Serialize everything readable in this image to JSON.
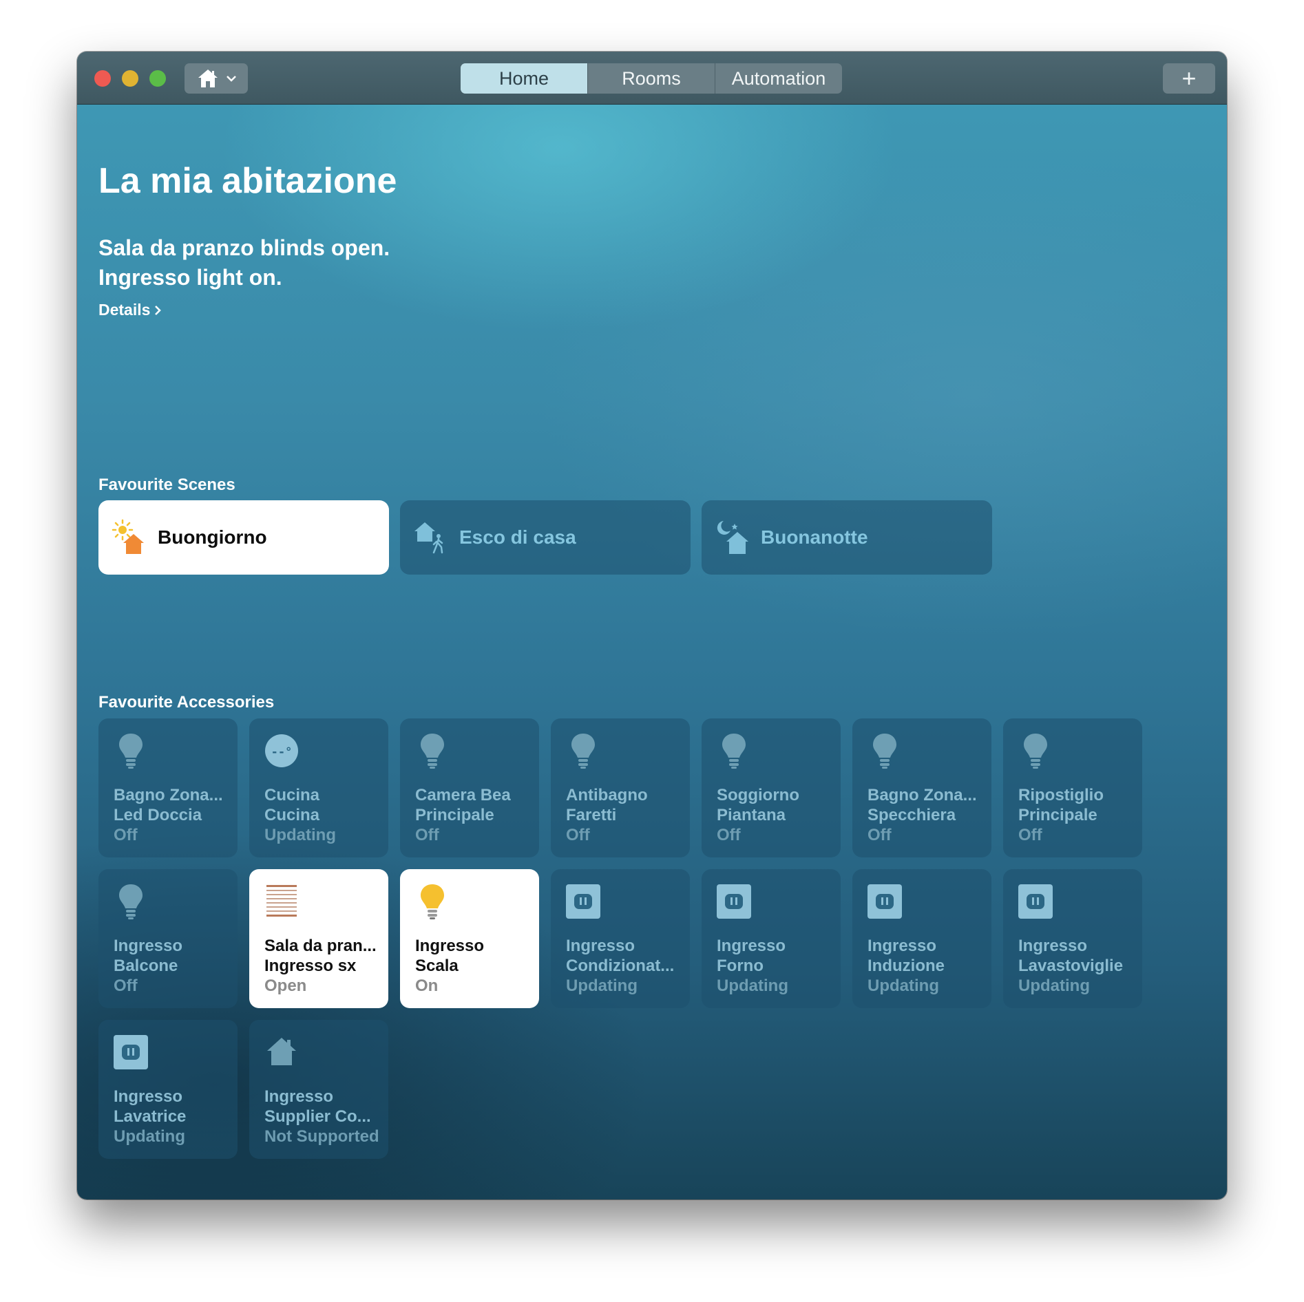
{
  "toolbar": {
    "tabs": [
      "Home",
      "Rooms",
      "Automation"
    ],
    "active_tab": "Home",
    "add_label": "+"
  },
  "home": {
    "title": "La mia abitazione",
    "status_lines": [
      "Sala da pranzo blinds open.",
      "Ingresso light on."
    ],
    "details_label": "Details"
  },
  "scenes": {
    "title": "Favourite Scenes",
    "items": [
      {
        "name": "Buongiorno",
        "icon": "sunrise-home-icon",
        "on": true
      },
      {
        "name": "Esco di casa",
        "icon": "leave-home-icon",
        "on": false
      },
      {
        "name": "Buonanotte",
        "icon": "night-home-icon",
        "on": false
      }
    ]
  },
  "accessories": {
    "title": "Favourite Accessories",
    "items": [
      {
        "room": "Bagno Zona...",
        "name": "Led Doccia",
        "state": "Off",
        "icon": "lightbulb-icon",
        "on": false
      },
      {
        "room": "Cucina",
        "name": "Cucina",
        "state": "Updating",
        "icon": "thermostat-icon",
        "on": false
      },
      {
        "room": "Camera Bea",
        "name": "Principale",
        "state": "Off",
        "icon": "lightbulb-icon",
        "on": false
      },
      {
        "room": "Antibagno",
        "name": "Faretti",
        "state": "Off",
        "icon": "lightbulb-icon",
        "on": false
      },
      {
        "room": "Soggiorno",
        "name": "Piantana",
        "state": "Off",
        "icon": "lightbulb-icon",
        "on": false
      },
      {
        "room": "Bagno Zona...",
        "name": "Specchiera",
        "state": "Off",
        "icon": "lightbulb-icon",
        "on": false
      },
      {
        "room": "Ripostiglio",
        "name": "Principale",
        "state": "Off",
        "icon": "lightbulb-icon",
        "on": false
      },
      {
        "room": "Ingresso",
        "name": "Balcone",
        "state": "Off",
        "icon": "lightbulb-icon",
        "on": false
      },
      {
        "room": "Sala da pran...",
        "name": "Ingresso sx",
        "state": "Open",
        "icon": "blinds-icon",
        "on": true
      },
      {
        "room": "Ingresso",
        "name": "Scala",
        "state": "On",
        "icon": "lightbulb-on-icon",
        "on": true
      },
      {
        "room": "Ingresso",
        "name": "Condizionat...",
        "state": "Updating",
        "icon": "outlet-icon",
        "on": false
      },
      {
        "room": "Ingresso",
        "name": "Forno",
        "state": "Updating",
        "icon": "outlet-icon",
        "on": false
      },
      {
        "room": "Ingresso",
        "name": "Induzione",
        "state": "Updating",
        "icon": "outlet-icon",
        "on": false
      },
      {
        "room": "Ingresso",
        "name": "Lavastoviglie",
        "state": "Updating",
        "icon": "outlet-icon",
        "on": false
      },
      {
        "room": "Ingresso",
        "name": "Lavatrice",
        "state": "Updating",
        "icon": "outlet-icon",
        "on": false
      },
      {
        "room": "Ingresso",
        "name": "Supplier Co...",
        "state": "Not Supported",
        "icon": "house-icon",
        "on": false
      }
    ]
  }
}
